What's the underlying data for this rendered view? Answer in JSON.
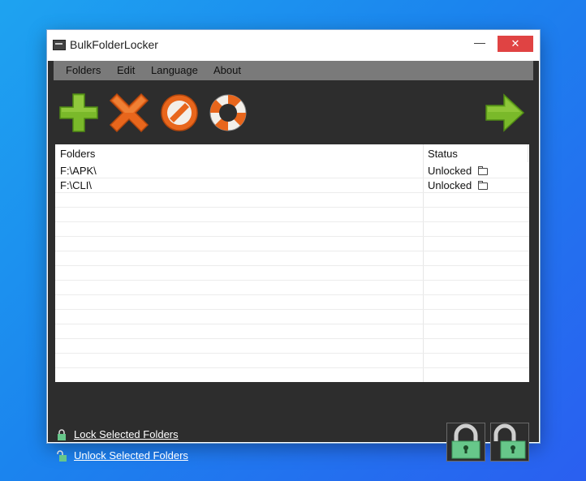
{
  "window": {
    "title": "BulkFolderLocker",
    "minimize_glyph": "—",
    "close_glyph": "✕"
  },
  "menu": [
    {
      "label": "Folders"
    },
    {
      "label": "Edit"
    },
    {
      "label": "Language"
    },
    {
      "label": "About"
    }
  ],
  "toolbar": {
    "icons": [
      "add-folder-icon",
      "remove-folder-icon",
      "clear-list-icon",
      "help-lifebuoy-icon",
      "next-arrow-icon"
    ]
  },
  "list": {
    "columns": {
      "folders": "Folders",
      "status": "Status"
    },
    "rows": [
      {
        "folder": "F:\\APK\\",
        "status": "Unlocked"
      },
      {
        "folder": "F:\\CLI\\",
        "status": "Unlocked"
      }
    ]
  },
  "actions": {
    "lock_selected": "Lock Selected Folders",
    "unlock_selected": "Unlock Selected Folders"
  },
  "colors": {
    "titlebar_close": "#e04343",
    "client_bg": "#2d2d2d",
    "menubar_bg": "#7a7a7a",
    "add_green": "#7ab92a",
    "remove_orange": "#e8661c",
    "lock_green": "#67c78a"
  }
}
